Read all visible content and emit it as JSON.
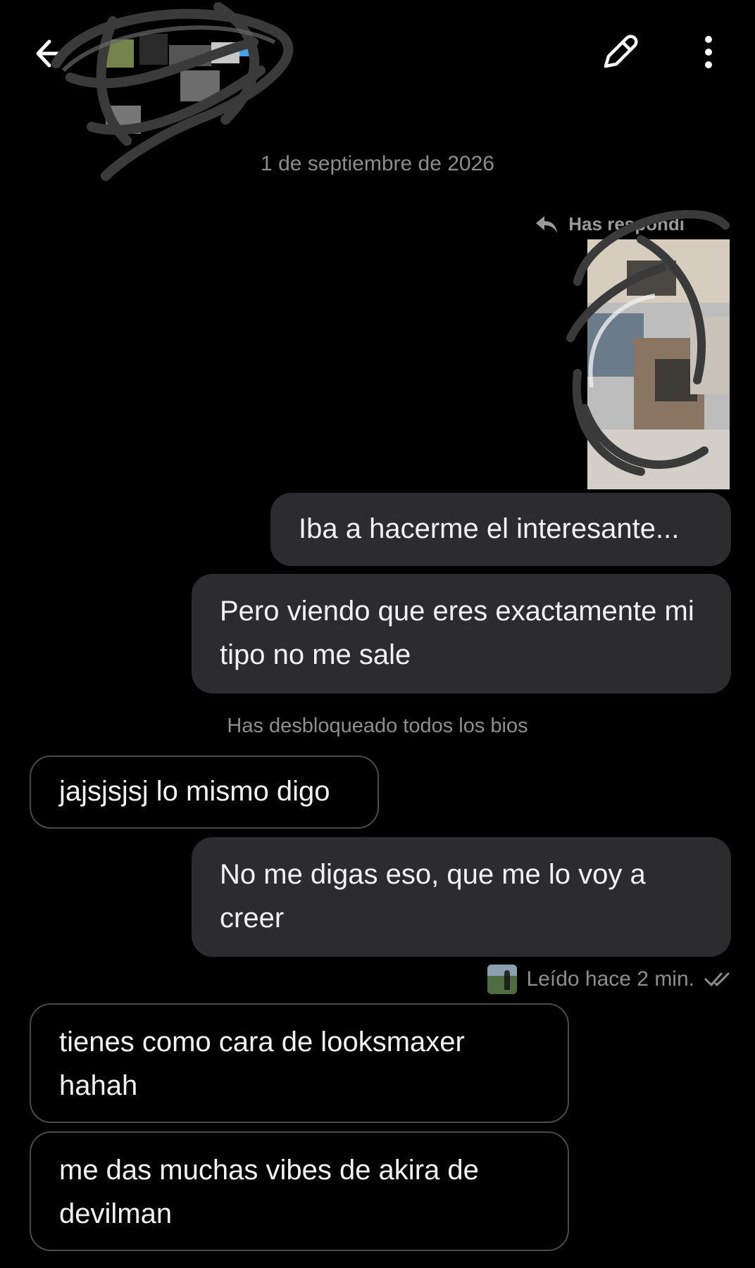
{
  "header": {
    "back_icon": "arrow-left-icon",
    "edit_icon": "pen-icon",
    "more_icon": "more-vertical-icon"
  },
  "date_label": "1 de septiembre de 2026",
  "reply_note": "Has respondi",
  "messages": [
    {
      "dir": "out",
      "text": "Iba a hacerme el interesante..."
    },
    {
      "dir": "out",
      "text": "Pero viendo que eres exactamente mi tipo no me sale"
    },
    {
      "dir": "in",
      "text": "jajsjsjsj lo mismo digo"
    },
    {
      "dir": "out",
      "text": "No me digas eso, que me lo voy a creer"
    },
    {
      "dir": "in",
      "text": "tienes como cara de looksmaxer hahah"
    },
    {
      "dir": "in",
      "text": "me das muchas vibes de akira de devilman"
    }
  ],
  "system_notice": "Has desbloqueado todos los bios",
  "read_receipt": "Leído hace 2 min.",
  "colors": {
    "background": "#000000",
    "outgoing_bubble": "#2c2c2e",
    "incoming_border": "#4a4a4a",
    "muted_text": "#8e8e8e"
  }
}
